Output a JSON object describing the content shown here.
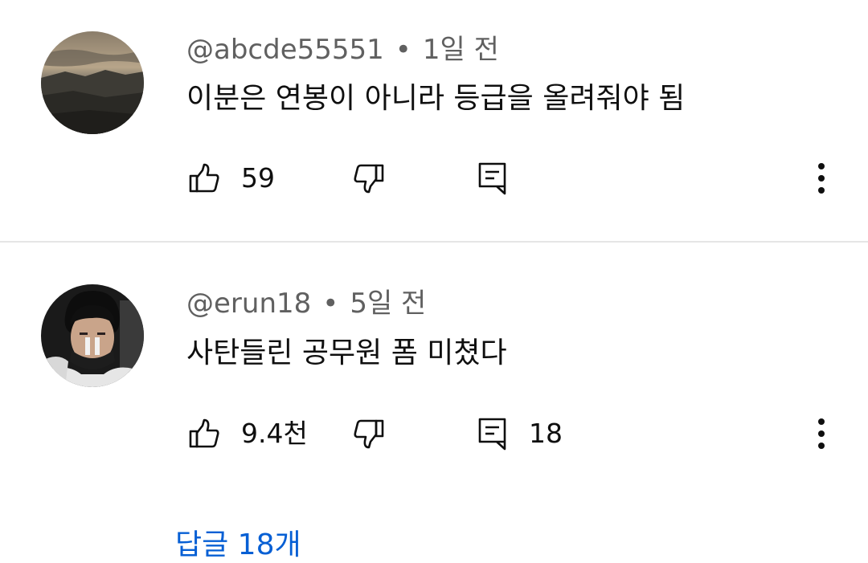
{
  "comments": [
    {
      "author": "@abcde55551",
      "time": "1일 전",
      "text": "이분은 연봉이 아니라 등급을 올려줘야 됨",
      "likes": "59",
      "replies_count": ""
    },
    {
      "author": "@erun18",
      "time": "5일 전",
      "text": "사탄들린 공무원 폼 미쳤다",
      "likes": "9.4천",
      "replies_count": "18"
    }
  ],
  "separator": "•",
  "replies_link": "답글 18개",
  "icons": {
    "like": "thumbs-up-icon",
    "dislike": "thumbs-down-icon",
    "reply": "comment-icon",
    "more": "more-vert-icon"
  },
  "colors": {
    "meta_text": "#606060",
    "primary_text": "#0f0f0f",
    "link": "#065fd4",
    "divider": "#e5e5e5"
  }
}
